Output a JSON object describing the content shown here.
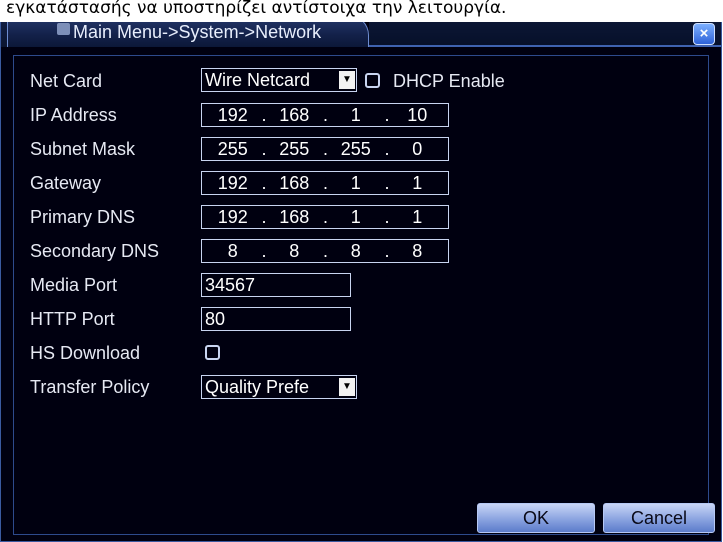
{
  "caption": "εγκατάστασής να υποστηρίζει αντίστοιχα την λειτουργία.",
  "title": "Main Menu->System->Network",
  "close_label": "×",
  "net_card": {
    "label": "Net Card",
    "value": "Wire Netcard"
  },
  "dhcp": {
    "label": "DHCP Enable",
    "checked": false
  },
  "ip_address": {
    "label": "IP Address",
    "octets": [
      "192",
      "168",
      "1",
      "10"
    ]
  },
  "subnet_mask": {
    "label": "Subnet Mask",
    "octets": [
      "255",
      "255",
      "255",
      "0"
    ]
  },
  "gateway": {
    "label": "Gateway",
    "octets": [
      "192",
      "168",
      "1",
      "1"
    ]
  },
  "primary_dns": {
    "label": "Primary DNS",
    "octets": [
      "192",
      "168",
      "1",
      "1"
    ]
  },
  "secondary_dns": {
    "label": "Secondary DNS",
    "octets": [
      "8",
      "8",
      "8",
      "8"
    ]
  },
  "media_port": {
    "label": "Media Port",
    "value": "34567"
  },
  "http_port": {
    "label": "HTTP Port",
    "value": "80"
  },
  "hs_download": {
    "label": "HS Download",
    "checked": false
  },
  "transfer_policy": {
    "label": "Transfer Policy",
    "value": "Quality Prefe"
  },
  "buttons": {
    "ok": "OK",
    "cancel": "Cancel"
  },
  "dot": "."
}
